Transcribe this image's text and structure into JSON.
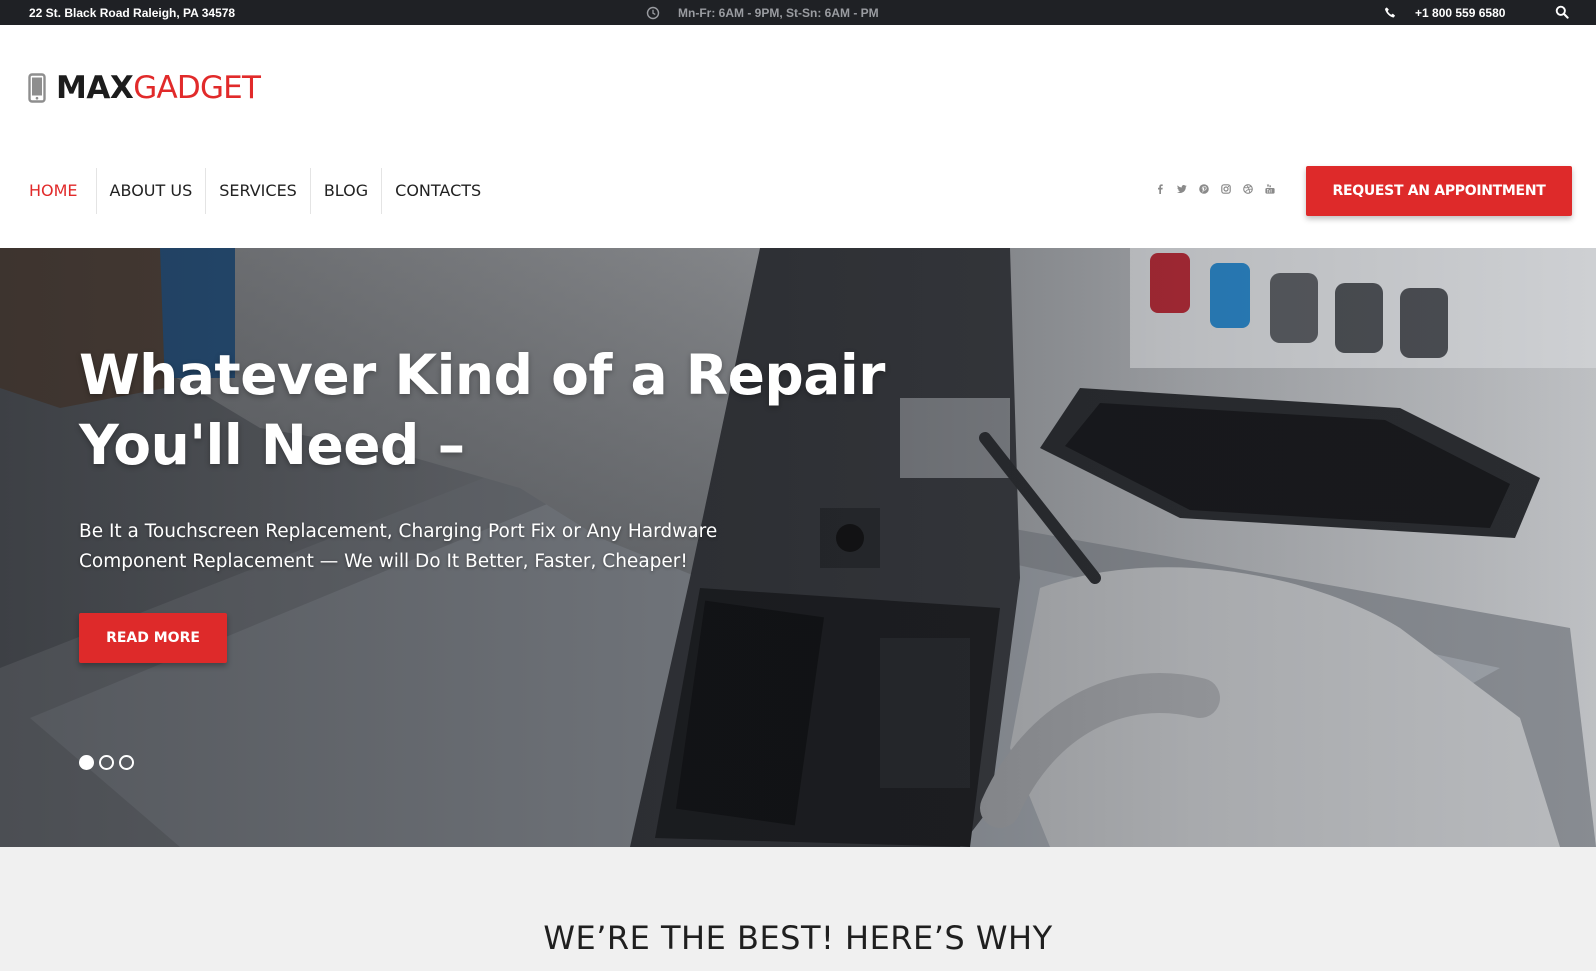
{
  "topbar": {
    "address": "22 St. Black Road Raleigh, PA 34578",
    "hours": "Mn-Fr: 6AM - 9PM, St-Sn: 6AM - PM",
    "phone": "+1 800 559 6580",
    "icons": [
      "clock-icon",
      "phone-icon",
      "search-icon"
    ]
  },
  "logo": {
    "bold": "MAX",
    "light": "GADGET",
    "icon": "mobile-device-icon"
  },
  "nav": {
    "items": [
      {
        "label": "HOME",
        "active": true
      },
      {
        "label": "ABOUT US"
      },
      {
        "label": "SERVICES"
      },
      {
        "label": "BLOG"
      },
      {
        "label": "CONTACTS"
      }
    ]
  },
  "social": [
    "facebook-icon",
    "twitter-icon",
    "pinterest-icon",
    "instagram-icon",
    "dribbble-icon",
    "youtube-icon"
  ],
  "cta": {
    "label": "REQUEST AN APPOINTMENT"
  },
  "hero": {
    "title_line1": "Whatever Kind of a Repair",
    "title_line2": "You'll Need –",
    "subtitle": "Be It a Touchscreen Replacement, Charging Port Fix or Any Hardware Component Replacement — We will Do It Better, Faster, Cheaper!",
    "button": "READ MORE",
    "slides": 3,
    "active_slide": 1
  },
  "why": {
    "title": "WE’RE THE BEST! HERE’S WHY"
  },
  "colors": {
    "accent": "#de2a2a",
    "topbar_bg": "#1f2125",
    "section_bg": "#f0f0f0"
  }
}
